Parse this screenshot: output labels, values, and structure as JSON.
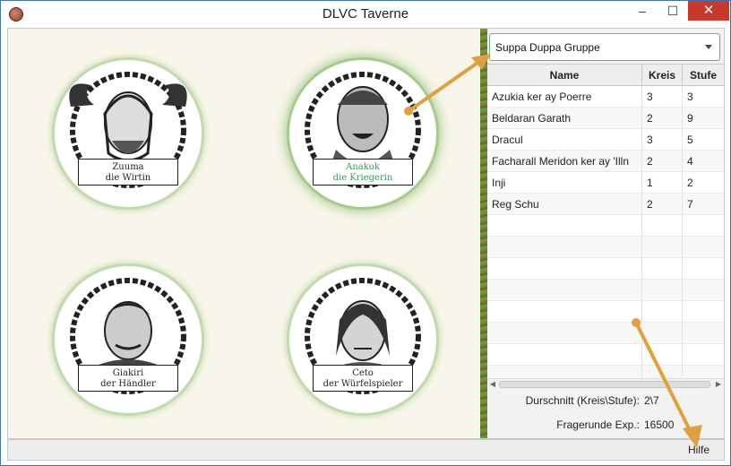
{
  "window": {
    "title": "DLVC Taverne",
    "minimize": "–",
    "maximize": "☐",
    "close": "✕"
  },
  "portraits": [
    {
      "line1": "Zuuma",
      "line2": "die Wirtin",
      "selected": false
    },
    {
      "line1": "Anakok",
      "line2": "die Kriegerin",
      "selected": true
    },
    {
      "line1": "Giakiri",
      "line2": "der Händler",
      "selected": false
    },
    {
      "line1": "Ceto",
      "line2": "der Würfelspieler",
      "selected": false
    }
  ],
  "group_select": {
    "value": "Suppa Duppa Gruppe"
  },
  "table": {
    "headers": {
      "name": "Name",
      "kreis": "Kreis",
      "stufe": "Stufe"
    },
    "rows": [
      {
        "name": "Azukia ker ay Poerre",
        "kreis": "3",
        "stufe": "3"
      },
      {
        "name": "Beldaran Garath",
        "kreis": "2",
        "stufe": "9"
      },
      {
        "name": "Dracul",
        "kreis": "3",
        "stufe": "5"
      },
      {
        "name": "Facharall Meridon ker ay 'Illn",
        "kreis": "2",
        "stufe": "4"
      },
      {
        "name": "Inji",
        "kreis": "1",
        "stufe": "2"
      },
      {
        "name": "Reg Schu",
        "kreis": "2",
        "stufe": "7"
      }
    ]
  },
  "summary": {
    "avg_label": "Durschnitt (Kreis\\Stufe):",
    "avg_value": "2\\7",
    "exp_label": "Fragerunde Exp.:",
    "exp_value": "16500"
  },
  "status": {
    "help": "Hilfe"
  },
  "colors": {
    "accent_green": "#6dae7f",
    "arrow": "#e0a040",
    "close_red": "#c7392b"
  }
}
